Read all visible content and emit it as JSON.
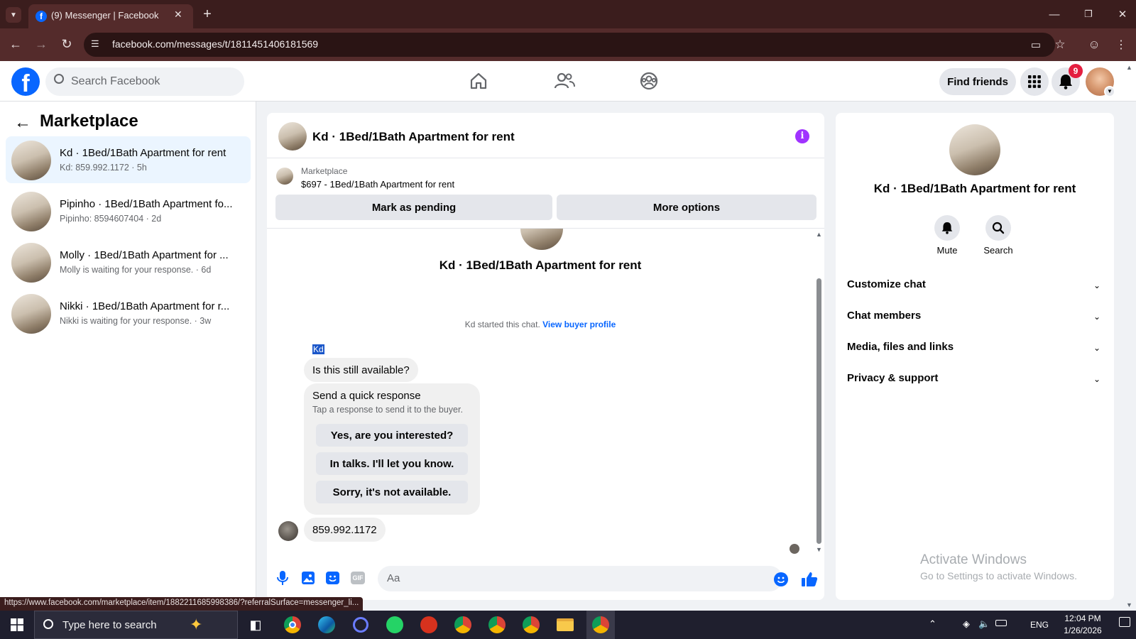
{
  "browser": {
    "tab_title": "(9) Messenger | Facebook",
    "url": "facebook.com/messages/t/1811451406181569",
    "status_url": "https://www.facebook.com/marketplace/item/1882211685998386/?referralSurface=messenger_li..."
  },
  "fb_header": {
    "search_placeholder": "Search Facebook",
    "find_friends": "Find friends",
    "notification_count": "9"
  },
  "sidebar": {
    "title": "Marketplace",
    "conversations": [
      {
        "name": "Kd · 1Bed/1Bath Apartment for rent",
        "sub": "Kd: 859.992.1172 · 5h"
      },
      {
        "name": "Pipinho · 1Bed/1Bath Apartment fo...",
        "sub": "Pipinho: 8594607404 · 2d"
      },
      {
        "name": "Molly · 1Bed/1Bath Apartment for ...",
        "sub": "Molly is waiting for your response. · 6d"
      },
      {
        "name": "Nikki · 1Bed/1Bath Apartment for r...",
        "sub": "Nikki is waiting for your response. · 3w"
      }
    ]
  },
  "chat": {
    "title": "Kd · 1Bed/1Bath Apartment for rent",
    "listing_label": "Marketplace",
    "listing_price": "$697 - 1Bed/1Bath Apartment for rent",
    "mark_pending": "Mark as pending",
    "more_options": "More options",
    "intro_name": "Kd · 1Bed/1Bath Apartment for rent",
    "started_text": "Kd started this chat.",
    "view_profile": "View buyer profile",
    "sender_label": "Kd",
    "message1": "Is this still available?",
    "quick_title": "Send a quick response",
    "quick_sub": "Tap a response to send it to the buyer.",
    "quick_replies": [
      "Yes, are you interested?",
      "In talks. I'll let you know.",
      "Sorry, it's not available."
    ],
    "message2": "859.992.1172",
    "composer_placeholder": "Aa",
    "accent_color": "#0866ff"
  },
  "details": {
    "name": "Kd · 1Bed/1Bath Apartment for rent",
    "mute": "Mute",
    "search": "Search",
    "sections": [
      "Customize chat",
      "Chat members",
      "Media, files and links",
      "Privacy & support"
    ],
    "watermark_title": "Activate Windows",
    "watermark_sub": "Go to Settings to activate Windows."
  },
  "taskbar": {
    "search_placeholder": "Type here to search",
    "lang": "ENG",
    "time": "12:04 PM",
    "date": "1/26/2026"
  }
}
